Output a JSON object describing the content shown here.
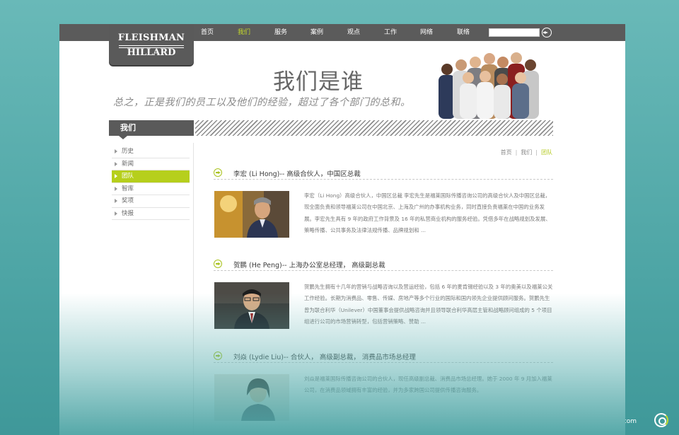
{
  "nav": {
    "items": [
      "首页",
      "我们",
      "服务",
      "案例",
      "观点",
      "工作",
      "网络",
      "联络"
    ],
    "active_index": 1,
    "search_value": ""
  },
  "logo": {
    "line1": "FLEISHMAN",
    "line2": "HILLARD",
    "tagline": "INTERNATIONAL COMMUNICATIONS"
  },
  "hero": {
    "title": "我们是谁",
    "subtitle": "总之，正是我们的员工以及他们的经验，超过了各个部门的总和。"
  },
  "section": {
    "title": "我们"
  },
  "sidebar": {
    "items": [
      "历史",
      "新闻",
      "团队",
      "智库",
      "奖项",
      "快报"
    ],
    "active_index": 2
  },
  "breadcrumb": {
    "home": "首页",
    "parent": "我们",
    "current": "团队"
  },
  "entries": [
    {
      "name": "李宏 (Li Hong)-- 高级合伙人，中国区总裁",
      "text": "李宏（Li Hong）高级合伙人，中国区总裁 李宏先生是福莱国际传播咨询公司的高级合伙人及中国区总裁，现全面负责和领导福莱公司在中国北京、上海及广州的办事机构业务，同时直接负责福莱在中国的业务发展。李宏先生具有 9 年的政府工作背景及 16 年的私营商业机构的服务经验。凭借多年在战略规划及发展、策略传播、公共事务及法律法规传播、品牌规划和 ..."
    },
    {
      "name": "贺鹏 (He Peng)-- 上海办公室总经理， 高级副总裁",
      "text": "贺鹏先生拥有十几年的营销与战略咨询以及营运经验，包括 6 年的麦肯锡经验以及 3 年的奥美以及福莱公关工作经验。长期为消费品、零售、传媒、房地产等多个行业的国际和国内领先企业提供顾问服务。贺鹏先生曾为联合利华（Unilever）中国董事会提供战略咨询并且领导联合利华高层主管和战略顾问组成的 5 个项目组进行公司的市场营销转型，包括营销策略、赞助 ..."
    },
    {
      "name": "刘焱 (Lydie Liu)-- 合伙人， 高级副总裁， 消费品市场总经理",
      "text": "刘焱是福莱国际传播咨询公司的合伙人，现任高级副总裁、消费品市场总经理。她于 2000 年 9 月加入福莱公司，在消费品领域拥有丰富的经验，并为多家跨国公司提供传播咨询服务。"
    }
  ],
  "watermark": "© ribo-ad.com",
  "colors": {
    "accent": "#b6cf1c",
    "nav_bg": "#5b5b5b",
    "background": "#5fb2b2"
  }
}
